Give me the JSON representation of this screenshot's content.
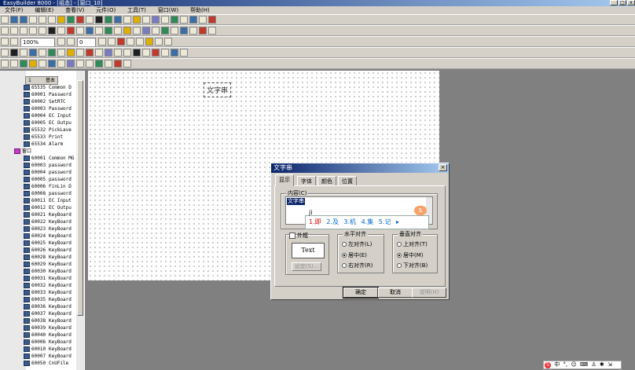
{
  "window": {
    "title": "EasyBuilder 8000 - [组态] - [窗口_10]"
  },
  "menu": [
    "文件(F)",
    "编辑(E)",
    "查看(V)",
    "元件(O)",
    "工具(T)",
    "窗口(W)",
    "帮助(H)"
  ],
  "toolbar": {
    "zoom": "100%",
    "layer": "0"
  },
  "tree": {
    "header": "基本",
    "header_num": "1",
    "group1": [
      {
        "num": "65535",
        "name": "Common D"
      },
      {
        "num": "60001",
        "name": "Password"
      },
      {
        "num": "60002",
        "name": "SetRTC"
      },
      {
        "num": "60003",
        "name": "Password"
      },
      {
        "num": "60004",
        "name": "EC Input"
      },
      {
        "num": "60005",
        "name": "EC Outpu"
      },
      {
        "num": "65532",
        "name": "PickLave"
      },
      {
        "num": "65533",
        "name": "Print"
      },
      {
        "num": "65534",
        "name": "Alarm"
      }
    ],
    "folder": "窗口",
    "group2": [
      {
        "num": "60001",
        "name": "Common MG"
      },
      {
        "num": "60003",
        "name": "password"
      },
      {
        "num": "60004",
        "name": "password"
      },
      {
        "num": "60005",
        "name": "password"
      },
      {
        "num": "60006",
        "name": "FinLin D"
      },
      {
        "num": "60008",
        "name": "password"
      },
      {
        "num": "60011",
        "name": "EC Input"
      },
      {
        "num": "60012",
        "name": "EC Outpu"
      },
      {
        "num": "60021",
        "name": "KeyBoard"
      },
      {
        "num": "60022",
        "name": "KeyBoard"
      },
      {
        "num": "60023",
        "name": "KeyBoard"
      },
      {
        "num": "60024",
        "name": "KeyBoard"
      },
      {
        "num": "60025",
        "name": "KeyBoard"
      },
      {
        "num": "60026",
        "name": "KeyBoard"
      },
      {
        "num": "60028",
        "name": "KeyBoard"
      },
      {
        "num": "60029",
        "name": "KeyBoard"
      },
      {
        "num": "60030",
        "name": "KeyBoard"
      },
      {
        "num": "60031",
        "name": "KeyBoard"
      },
      {
        "num": "60032",
        "name": "KeyBoard"
      },
      {
        "num": "60033",
        "name": "KeyBoard"
      },
      {
        "num": "60035",
        "name": "KeyBoard"
      },
      {
        "num": "60036",
        "name": "KeyBoard"
      },
      {
        "num": "60037",
        "name": "KeyBoard"
      },
      {
        "num": "60038",
        "name": "KeyBoard"
      },
      {
        "num": "60039",
        "name": "KeyBoard"
      },
      {
        "num": "60040",
        "name": "KeyBoard"
      },
      {
        "num": "60006",
        "name": "KeyBoard"
      },
      {
        "num": "60010",
        "name": "KeyBoard"
      },
      {
        "num": "60007",
        "name": "KeyBoard"
      },
      {
        "num": "60050",
        "name": "CnUFile"
      }
    ]
  },
  "canvas": {
    "text_object": "文字串"
  },
  "dialog": {
    "title": "文字串",
    "close": "×",
    "tabs": [
      "显示",
      "字体",
      "颜色",
      "位置"
    ],
    "content_label": "内容(C)",
    "content_value": "文字串",
    "ime": {
      "input": "ji",
      "candidates": [
        "1.即",
        "2.及",
        "3.机",
        "4.集",
        "5.记"
      ],
      "arrow": "▸",
      "logo": "S"
    },
    "frame_checkbox": "外框",
    "preview_text": "Text",
    "settings_button": "设定(S)...",
    "halign": {
      "label": "水平对齐",
      "options": [
        "左对齐(L)",
        "居中(E)",
        "右对齐(R)"
      ],
      "selected": 1
    },
    "valign": {
      "label": "垂直对齐",
      "options": [
        "上对齐(T)",
        "居中(M)",
        "下对齐(B)"
      ],
      "selected": 1
    },
    "buttons": {
      "ok": "确定",
      "cancel": "取消",
      "help": "说明(H)"
    }
  },
  "tray": {
    "items": [
      "中",
      "°,",
      "☺",
      "⌨",
      "♙",
      "✱",
      "⇲"
    ]
  }
}
